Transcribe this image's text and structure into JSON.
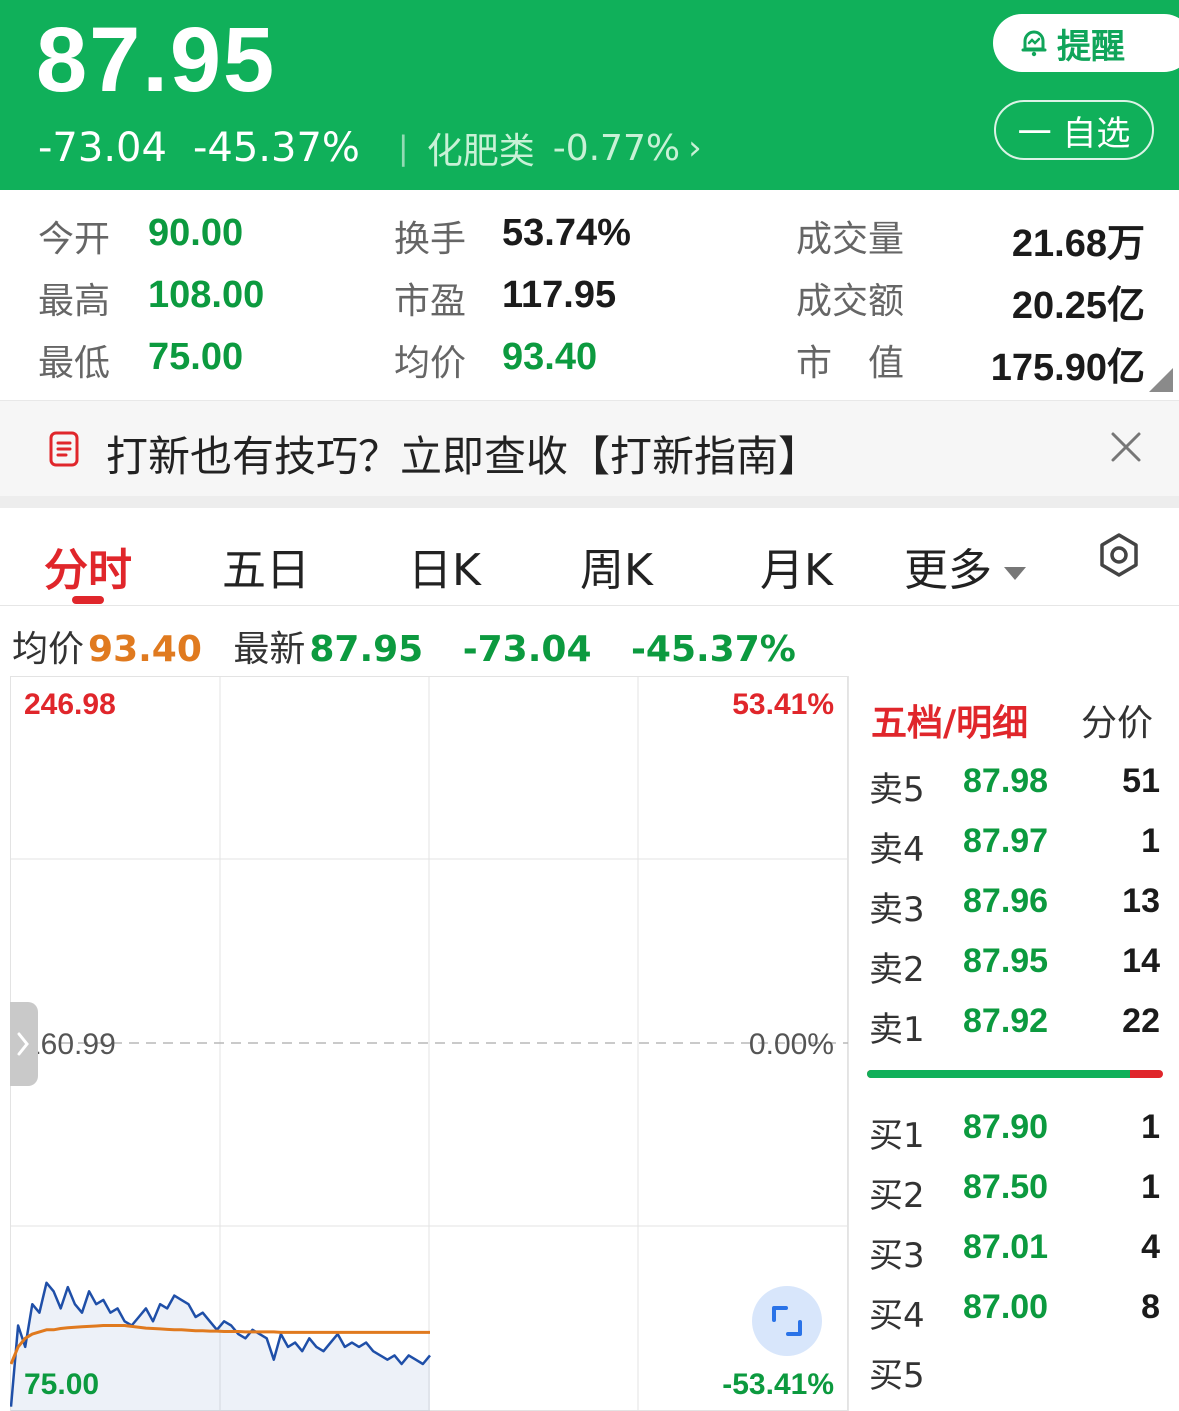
{
  "header": {
    "price": "87.95",
    "change": "-73.04",
    "change_pct": "-45.37%",
    "separator": "|",
    "sector": "化肥类",
    "sector_change": "-0.77%",
    "sector_arrow": "›",
    "remind_label": "提醒",
    "watchlist_label": "一 自选",
    "colors": {
      "header_bg": "#10b05a",
      "down": "#0c9a3f",
      "up": "#e0262b",
      "avg": "#e07a1f"
    }
  },
  "stats": {
    "open_label": "今开",
    "open": "90.00",
    "high_label": "最高",
    "high": "108.00",
    "low_label": "最低",
    "low": "75.00",
    "turnover_label": "换手",
    "turnover": "53.74%",
    "pe_label": "市盈",
    "pe": "117.95",
    "avg_label": "均价",
    "avg": "93.40",
    "volume_label": "成交量",
    "volume": "21.68万",
    "amount_label": "成交额",
    "amount": "20.25亿",
    "mktcap_label": "市　值",
    "mktcap": "175.90亿"
  },
  "banner": {
    "text": "打新也有技巧？立即查收【打新指南】",
    "icon": "document-icon",
    "close_icon": "close-icon"
  },
  "tabs": [
    "分时",
    "五日",
    "日K",
    "周K",
    "月K",
    "更多"
  ],
  "info": {
    "avg_label": "均价",
    "avg": "93.40",
    "latest_label": "最新",
    "latest": "87.95",
    "change": "-73.04",
    "change_pct": "-45.37%"
  },
  "chart": {
    "top_price": "246.98",
    "top_pct": "53.41%",
    "mid_price": "160.99",
    "mid_pct": "0.00%",
    "bottom_price": "75.00",
    "bottom_pct": "-53.41%"
  },
  "chart_data": {
    "type": "line",
    "ylim": [
      75.0,
      246.98
    ],
    "reference": 160.99,
    "series": [
      {
        "values": [
          76,
          95,
          90,
          100,
          98,
          105,
          103,
          99,
          104,
          100,
          98,
          103,
          100,
          101,
          98,
          99,
          96,
          95,
          97,
          99,
          96,
          100,
          99,
          102,
          101,
          100,
          97,
          98,
          96,
          94,
          96,
          95,
          93,
          92,
          94,
          93,
          92,
          87,
          93,
          90,
          91,
          89,
          92,
          90,
          89,
          91,
          93,
          90,
          91,
          90,
          91,
          89,
          88,
          87,
          88,
          86,
          88,
          87,
          86,
          88
        ]
      },
      {
        "values": [
          86,
          90,
          92,
          93,
          93.5,
          94,
          94,
          94.3,
          94.5,
          94.6,
          94.7,
          94.8,
          94.9,
          95,
          95,
          95,
          95,
          94.8,
          94.6,
          94.4,
          94.3,
          94.2,
          94.1,
          94,
          94,
          93.9,
          93.8,
          93.8,
          93.7,
          93.7,
          93.6,
          93.6,
          93.6,
          93.5,
          93.5,
          93.5,
          93.5,
          93.5,
          93.4,
          93.4,
          93.4,
          93.4,
          93.4,
          93.4,
          93.4,
          93.4,
          93.4,
          93.4,
          93.4,
          93.4,
          93.4,
          93.4,
          93.4,
          93.4,
          93.4,
          93.4,
          93.4,
          93.4,
          93.4,
          93.4
        ]
      }
    ],
    "series_colors": [
      "#1f4fa8",
      "#e07a1f"
    ]
  },
  "book": {
    "title": "五档/明细",
    "title2": "分价",
    "asks": [
      {
        "label": "卖5",
        "price": "87.98",
        "vol": "51"
      },
      {
        "label": "卖4",
        "price": "87.97",
        "vol": "1"
      },
      {
        "label": "卖3",
        "price": "87.96",
        "vol": "13"
      },
      {
        "label": "卖2",
        "price": "87.95",
        "vol": "14"
      },
      {
        "label": "卖1",
        "price": "87.92",
        "vol": "22"
      }
    ],
    "bids": [
      {
        "label": "买1",
        "price": "87.90",
        "vol": "1"
      },
      {
        "label": "买2",
        "price": "87.50",
        "vol": "1"
      },
      {
        "label": "买3",
        "price": "87.01",
        "vol": "4"
      },
      {
        "label": "买4",
        "price": "87.00",
        "vol": "8"
      },
      {
        "label": "买5",
        "price": "",
        "vol": ""
      }
    ],
    "ratio": 0.89
  }
}
